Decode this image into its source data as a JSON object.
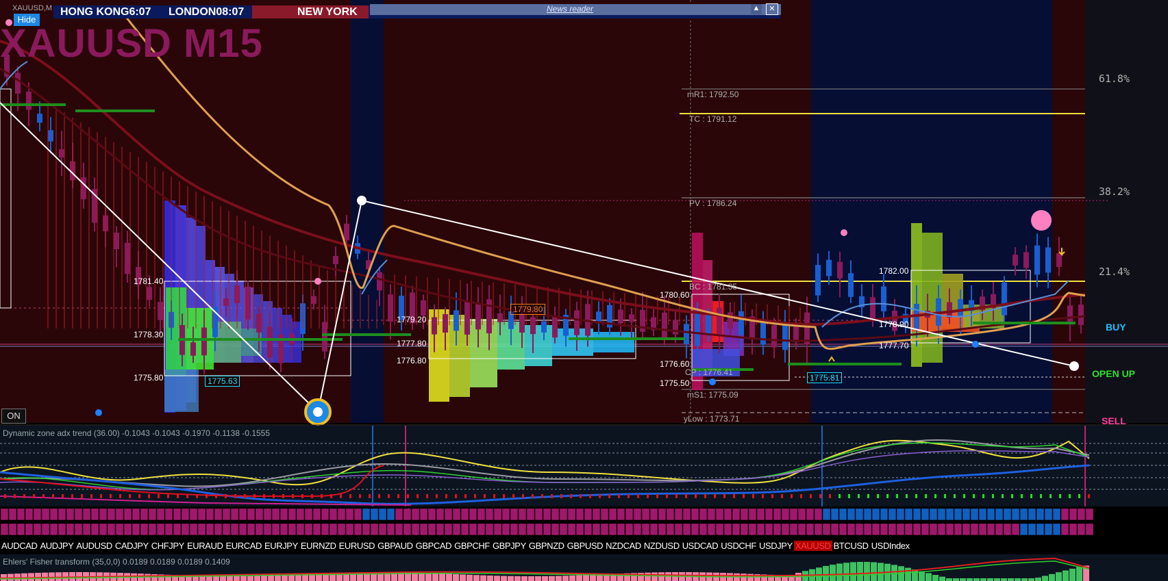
{
  "window": {
    "symbol_title": "XAUUSD M15",
    "corner_label": "XAUUSD,M",
    "hide_button": "Hide",
    "on_button": "ON"
  },
  "clocks": {
    "hong_kong": "HONG KONG6:07",
    "london": "LONDON08:07",
    "new_york": "NEW YORK"
  },
  "news_reader": {
    "label": "News reader"
  },
  "fibo_levels": [
    {
      "label": "61.8%"
    },
    {
      "label": "38.2%"
    },
    {
      "label": "21.4%"
    }
  ],
  "pivots": {
    "mR1": "mR1: 1792.50",
    "TC": "TC : 1791.12",
    "PV": "PV : 1786.24",
    "BC": "BC : 1781.35",
    "CP": "CP : 1776.41",
    "mS1": "mS1: 1775.09",
    "yLow": "yLow : 1773.71"
  },
  "price_labels": {
    "p1781_40": "1781.40",
    "p1778_30": "1778.30",
    "p1775_80": "1775.80",
    "p1775_63": "1775.63",
    "p1779_20": "1779.20",
    "p1779_80": "1779.80",
    "p1777_80": "1777.80",
    "p1776_80": "1776.80",
    "p1780_60": "1780.60",
    "p1776_60": "1776.60",
    "p1775_50": "1775.50",
    "p1775_81": "1775.81",
    "p1782_00": "1782.00",
    "p1778_90": "1778.90",
    "p1777_70": "1777.70"
  },
  "signals": {
    "buy": "BUY",
    "open_up": "OPEN UP",
    "sell": "SELL"
  },
  "indicators": {
    "adx": "Dynamic zone adx trend (36.00) -0.1043 -0.1043 -0.1970 -0.1138 -0.1555",
    "fisher": "Ehlers' Fisher transform (35,0,0) 0.0189 0.0189 0.0189 0.1409"
  },
  "pairs": [
    "AUDCAD",
    "AUDJPY",
    "AUDUSD",
    "CADJPY",
    "CHFJPY",
    "EURAUD",
    "EURCAD",
    "EURJPY",
    "EURNZD",
    "EURUSD",
    "GBPAUD",
    "GBPCAD",
    "GBPCHF",
    "GBPJPY",
    "GBPNZD",
    "GBPUSD",
    "NZDCAD",
    "NZDUSD",
    "USDCAD",
    "USDCHF",
    "USDJPY",
    "XAUUSD",
    "BTCUSD",
    "USDIndex"
  ],
  "active_pair": "XAUUSD",
  "colors": {
    "session_red": "#2a0608",
    "session_navy": "#060e34",
    "panel_dark": "#0c1420",
    "bull_candle": "#1a5fd0",
    "bear_candle": "#8a1a5c",
    "accent_yellow": "#f0e040",
    "strip_magenta": "#a0186c",
    "strip_blue": "#1060c0"
  }
}
